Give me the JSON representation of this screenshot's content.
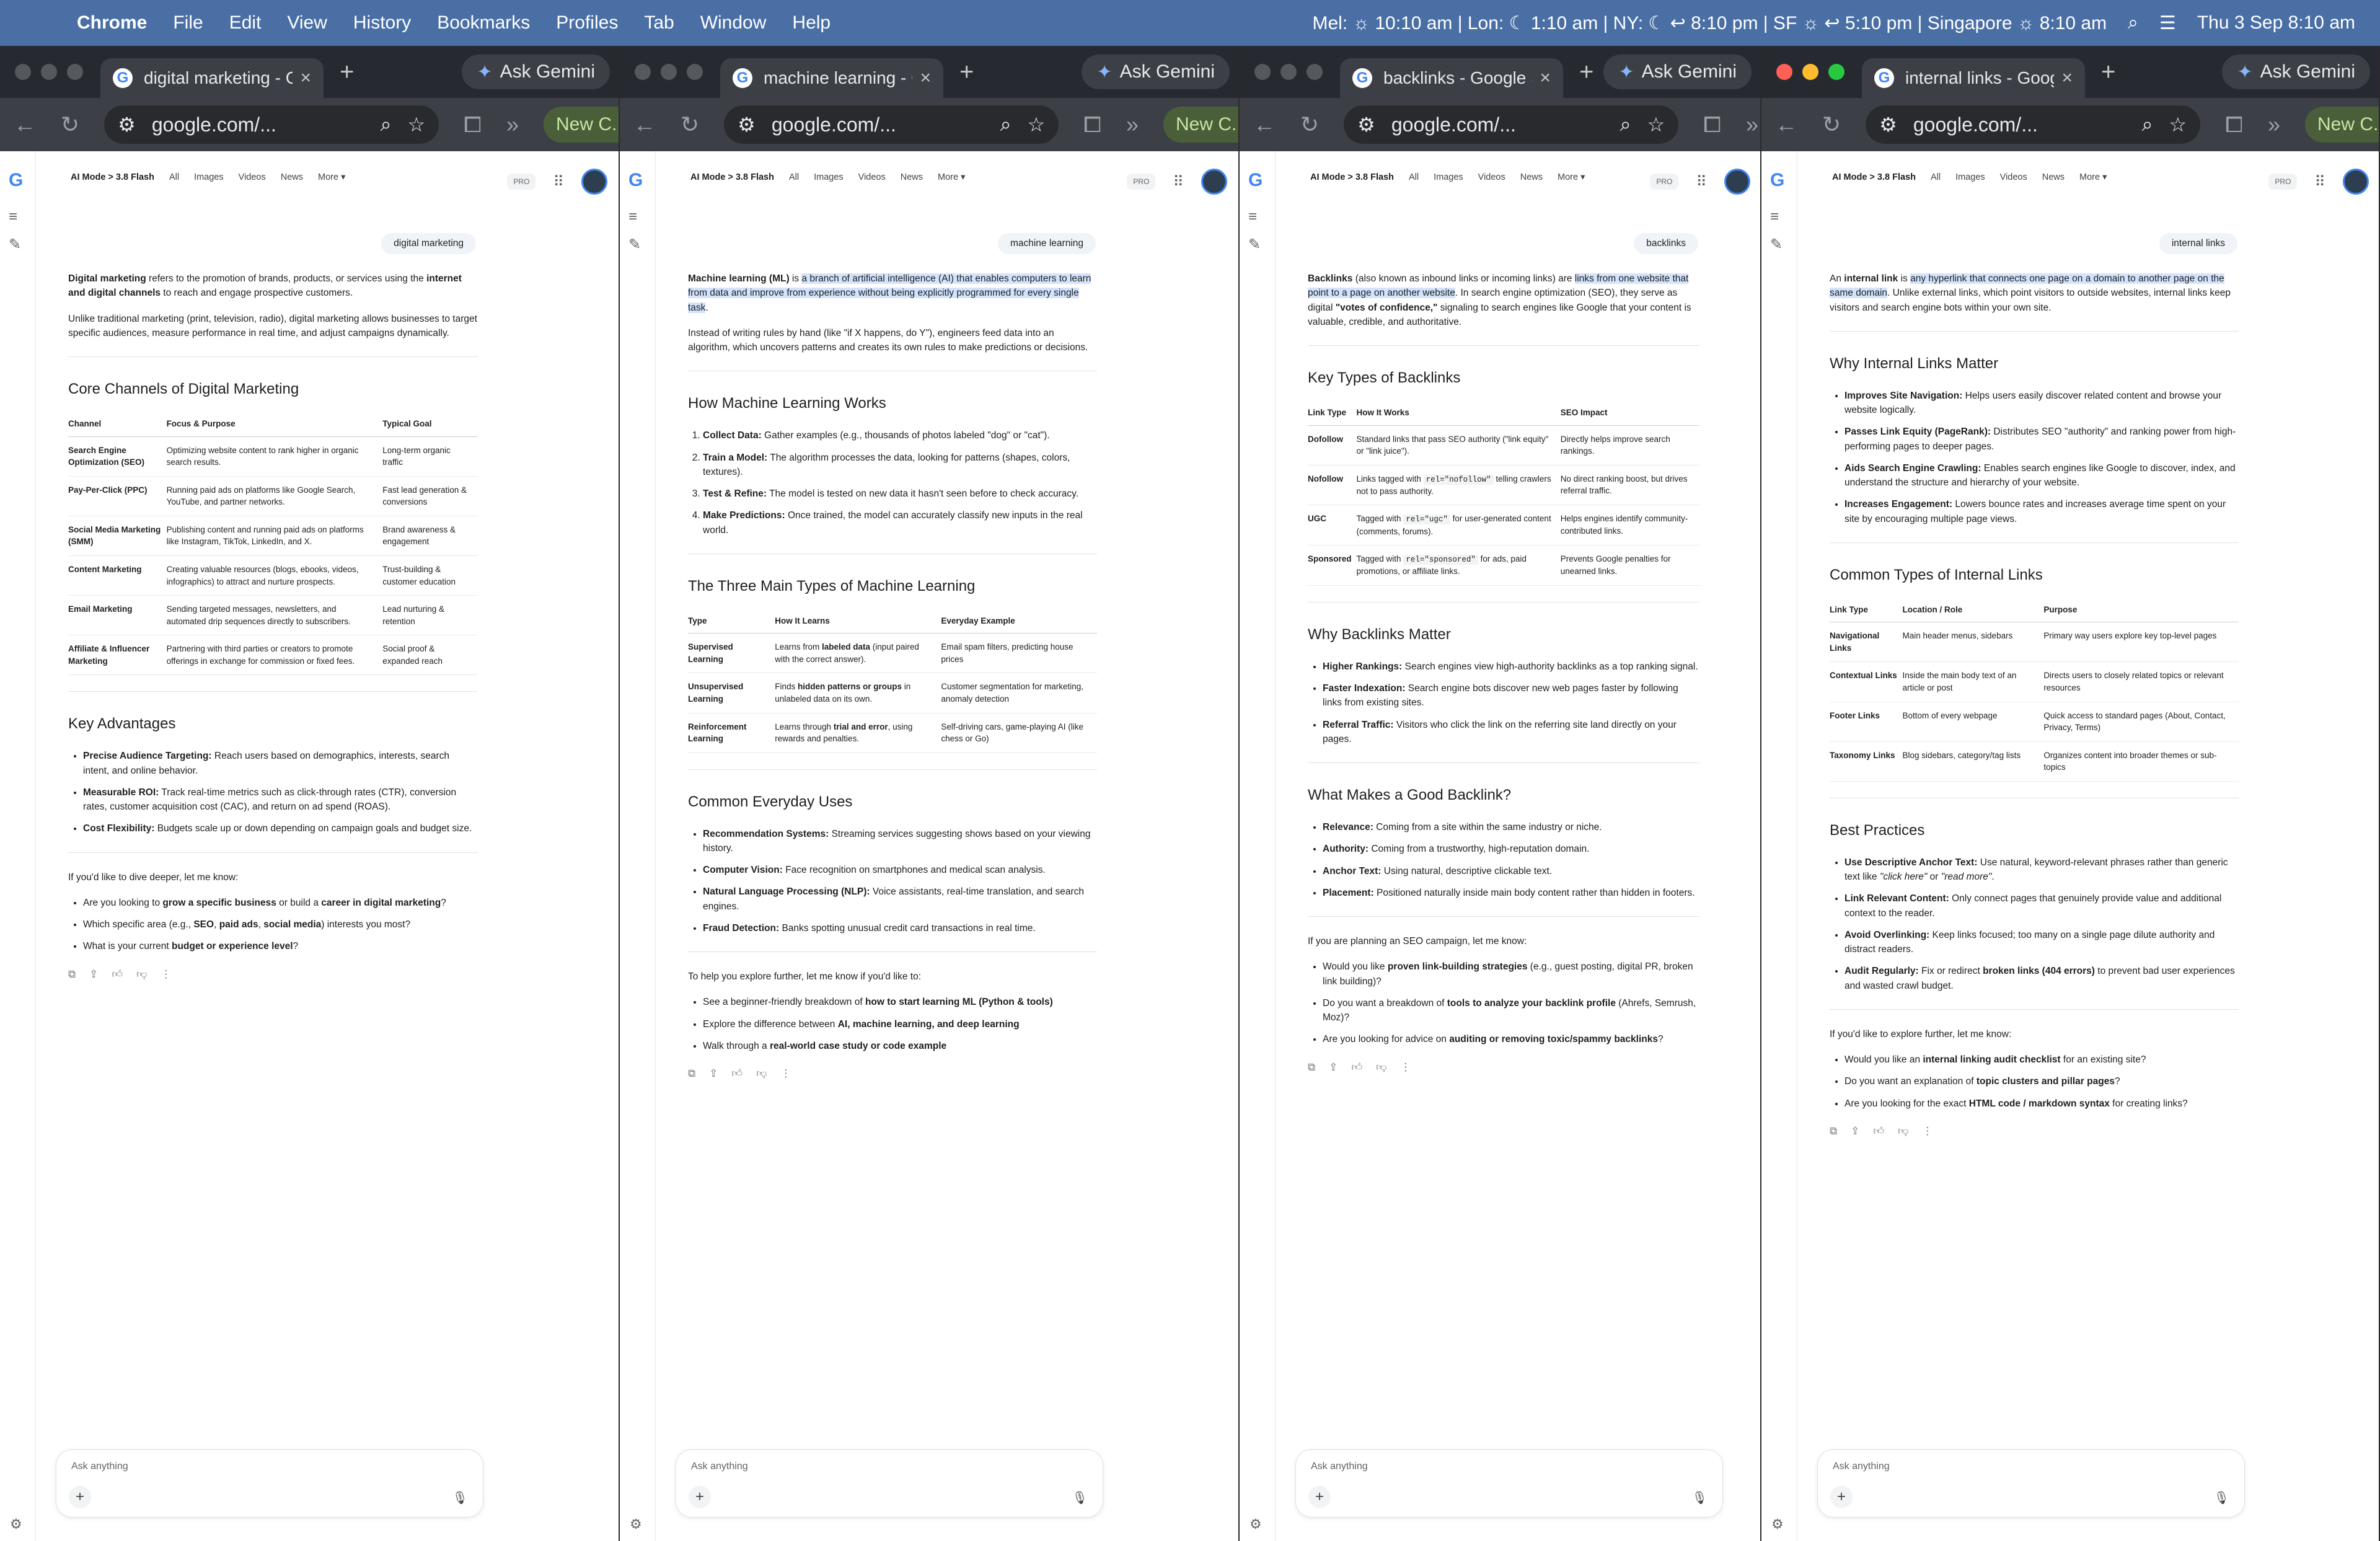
{
  "menubar": {
    "app": "Chrome",
    "items": [
      "File",
      "Edit",
      "View",
      "History",
      "Bookmarks",
      "Profiles",
      "Tab",
      "Window",
      "Help"
    ],
    "clock_strip": "Mel: ☼ 10:10 am | Lon: ☾ 1:10 am | NY: ☾ ↩ 8:10 pm | SF ☼ ↩ 5:10 pm | Singapore ☼ 8:10 am",
    "date": "Thu 3 Sep  8:10 am"
  },
  "common": {
    "ask_gemini": "Ask Gemini",
    "url": "google.com/...",
    "new_chat": "New C...",
    "nav_brand": "AI Mode > 3.8 Flash",
    "nav_items": [
      "All",
      "Images",
      "Videos",
      "News",
      "More ▾"
    ],
    "pro": "PRO",
    "ask_placeholder": "Ask anything"
  },
  "windows": [
    {
      "tab_title": "digital marketing - Google S",
      "query": "digital marketing",
      "intro": [
        "<b>Digital marketing</b> refers to the promotion of brands, products, or services using the <b>internet and digital channels</b> to reach and engage prospective customers.",
        "Unlike traditional marketing (print, television, radio), digital marketing allows businesses to target specific audiences, measure performance in real time, and adjust campaigns dynamically."
      ],
      "table_heading": "Core Channels of Digital Marketing",
      "table": {
        "headers": [
          "Channel",
          "Focus & Purpose",
          "Typical Goal"
        ],
        "rows": [
          [
            "Search Engine Optimization (SEO)",
            "Optimizing website content to rank higher in organic search results.",
            "Long-term organic traffic"
          ],
          [
            "Pay-Per-Click (PPC)",
            "Running paid ads on platforms like Google Search, YouTube, and partner networks.",
            "Fast lead generation & conversions"
          ],
          [
            "Social Media Marketing (SMM)",
            "Publishing content and running paid ads on platforms like Instagram, TikTok, LinkedIn, and X.",
            "Brand awareness & engagement"
          ],
          [
            "Content Marketing",
            "Creating valuable resources (blogs, ebooks, videos, infographics) to attract and nurture prospects.",
            "Trust-building & customer education"
          ],
          [
            "Email Marketing",
            "Sending targeted messages, newsletters, and automated drip sequences directly to subscribers.",
            "Lead nurturing & retention"
          ],
          [
            "Affiliate & Influencer Marketing",
            "Partnering with third parties or creators to promote offerings in exchange for commission or fixed fees.",
            "Social proof & expanded reach"
          ]
        ]
      },
      "list_heading": "Key Advantages",
      "list": [
        "<b>Precise Audience Targeting:</b> Reach users based on demographics, interests, search intent, and online behavior.",
        "<b>Measurable ROI:</b> Track real-time metrics such as click-through rates (CTR), conversion rates, customer acquisition cost (CAC), and return on ad spend (ROAS).",
        "<b>Cost Flexibility:</b> Budgets scale up or down depending on campaign goals and budget size."
      ],
      "followup_intro": "If you'd like to dive deeper, let me know:",
      "followups": [
        "Are you looking to <b>grow a specific business</b> or build a <b>career in digital marketing</b>?",
        "Which specific area (e.g., <b>SEO</b>, <b>paid ads</b>, <b>social media</b>) interests you most?",
        "What is your current <b>budget or experience level</b>?"
      ]
    },
    {
      "tab_title": "machine learning - Google S",
      "query": "machine learning",
      "intro": [
        "<b>Machine learning (ML)</b> is <span class=\"hl\">a branch of artificial intelligence (AI) that enables computers to learn from data and improve from experience without being explicitly programmed for every single task</span>.",
        "Instead of writing rules by hand (like \"if X happens, do Y\"), engineers feed data into an algorithm, which uncovers patterns and creates its own rules to make predictions or decisions."
      ],
      "steps_heading": "How Machine Learning Works",
      "steps": [
        "<b>Collect Data:</b> Gather examples (e.g., thousands of photos labeled \"dog\" or \"cat\").",
        "<b>Train a Model:</b> The algorithm processes the data, looking for patterns (shapes, colors, textures).",
        "<b>Test &amp; Refine:</b> The model is tested on new data it hasn't seen before to check accuracy.",
        "<b>Make Predictions:</b> Once trained, the model can accurately classify new inputs in the real world."
      ],
      "table_heading": "The Three Main Types of Machine Learning",
      "table": {
        "headers": [
          "Type",
          "How It Learns",
          "Everyday Example"
        ],
        "rows": [
          [
            "Supervised Learning",
            "Learns from <b>labeled data</b> (input paired with the correct answer).",
            "Email spam filters, predicting house prices"
          ],
          [
            "Unsupervised Learning",
            "Finds <b>hidden patterns or groups</b> in unlabeled data on its own.",
            "Customer segmentation for marketing, anomaly detection"
          ],
          [
            "Reinforcement Learning",
            "Learns through <b>trial and error</b>, using rewards and penalties.",
            "Self-driving cars, game-playing AI (like chess or Go)"
          ]
        ]
      },
      "list_heading": "Common Everyday Uses",
      "list": [
        "<b>Recommendation Systems:</b> Streaming services suggesting shows based on your viewing history.",
        "<b>Computer Vision:</b> Face recognition on smartphones and medical scan analysis.",
        "<b>Natural Language Processing (NLP):</b> Voice assistants, real-time translation, and search engines.",
        "<b>Fraud Detection:</b> Banks spotting unusual credit card transactions in real time."
      ],
      "followup_intro": "To help you explore further, let me know if you'd like to:",
      "followups": [
        "See a beginner-friendly breakdown of <b>how to start learning ML (Python &amp; tools)</b>",
        "Explore the difference between <b>AI, machine learning, and deep learning</b>",
        "Walk through a <b>real-world case study or code example</b>"
      ]
    },
    {
      "tab_title": "backlinks - Google Search",
      "query": "backlinks",
      "intro": [
        "<b>Backlinks</b> (also known as inbound links or incoming links) are <span class=\"hl\">links from one website that point to a page on another website</span>. In search engine optimization (SEO), they serve as digital <b>\"votes of confidence,\"</b> signaling to search engines like Google that your content is valuable, credible, and authoritative."
      ],
      "table_heading": "Key Types of Backlinks",
      "table": {
        "headers": [
          "Link Type",
          "How It Works",
          "SEO Impact"
        ],
        "rows": [
          [
            "Dofollow",
            "Standard links that pass SEO authority (\"link equity\" or \"link juice\").",
            "Directly helps improve search rankings."
          ],
          [
            "Nofollow",
            "Links tagged with <code>rel=\"nofollow\"</code> telling crawlers not to pass authority.",
            "No direct ranking boost, but drives referral traffic."
          ],
          [
            "UGC",
            "Tagged with <code>rel=\"ugc\"</code> for user-generated content (comments, forums).",
            "Helps engines identify community-contributed links."
          ],
          [
            "Sponsored",
            "Tagged with <code>rel=\"sponsored\"</code> for ads, paid promotions, or affiliate links.",
            "Prevents Google penalties for unearned links."
          ]
        ]
      },
      "list_heading": "Why Backlinks Matter",
      "list": [
        "<b>Higher Rankings:</b> Search engines view high-authority backlinks as a top ranking signal.",
        "<b>Faster Indexation:</b> Search engine bots discover new web pages faster by following links from existing sites.",
        "<b>Referral Traffic:</b> Visitors who click the link on the referring site land directly on your pages."
      ],
      "list2_heading": "What Makes a Good Backlink?",
      "list2": [
        "<b>Relevance:</b> Coming from a site within the same industry or niche.",
        "<b>Authority:</b> Coming from a trustworthy, high-reputation domain.",
        "<b>Anchor Text:</b> Using natural, descriptive clickable text.",
        "<b>Placement:</b> Positioned naturally inside main body content rather than hidden in footers."
      ],
      "followup_intro": "If you are planning an SEO campaign, let me know:",
      "followups": [
        "Would you like <b>proven link-building strategies</b> (e.g., guest posting, digital PR, broken link building)?",
        "Do you want a breakdown of <b>tools to analyze your backlink profile</b> (Ahrefs, Semrush, Moz)?",
        "Are you looking for advice on <b>auditing or removing toxic/spammy backlinks</b>?"
      ]
    },
    {
      "tab_title": "internal links - Google Se",
      "query": "internal links",
      "intro": [
        "An <b>internal link</b> is <span class=\"hl\">any hyperlink that connects one page on a domain to another page on the same domain</span>. Unlike external links, which point visitors to outside websites, internal links keep visitors and search engine bots within your own site."
      ],
      "list_heading": "Why Internal Links Matter",
      "list": [
        "<b>Improves Site Navigation:</b> Helps users easily discover related content and browse your website logically.",
        "<b>Passes Link Equity (PageRank):</b> Distributes SEO \"authority\" and ranking power from high-performing pages to deeper pages.",
        "<b>Aids Search Engine Crawling:</b> Enables search engines like Google to discover, index, and understand the structure and hierarchy of your website.",
        "<b>Increases Engagement:</b> Lowers bounce rates and increases average time spent on your site by encouraging multiple page views."
      ],
      "table_heading": "Common Types of Internal Links",
      "table": {
        "headers": [
          "Link Type",
          "Location / Role",
          "Purpose"
        ],
        "rows": [
          [
            "Navigational Links",
            "Main header menus, sidebars",
            "Primary way users explore key top-level pages"
          ],
          [
            "Contextual Links",
            "Inside the main body text of an article or post",
            "Directs users to closely related topics or relevant resources"
          ],
          [
            "Footer Links",
            "Bottom of every webpage",
            "Quick access to standard pages (About, Contact, Privacy, Terms)"
          ],
          [
            "Taxonomy Links",
            "Blog sidebars, category/tag lists",
            "Organizes content into broader themes or sub-topics"
          ]
        ]
      },
      "list2_heading": "Best Practices",
      "list2": [
        "<b>Use Descriptive Anchor Text:</b> Use natural, keyword-relevant phrases rather than generic text like <i>\"click here\"</i> or <i>\"read more\"</i>.",
        "<b>Link Relevant Content:</b> Only connect pages that genuinely provide value and additional context to the reader.",
        "<b>Avoid Overlinking:</b> Keep links focused; too many on a single page dilute authority and distract readers.",
        "<b>Audit Regularly:</b> Fix or redirect <b>broken links (404 errors)</b> to prevent bad user experiences and wasted crawl budget."
      ],
      "followup_intro": "If you'd like to explore further, let me know:",
      "followups": [
        "Would you like an <b>internal linking audit checklist</b> for an existing site?",
        "Do you want an explanation of <b>topic clusters and pillar pages</b>?",
        "Are you looking for the exact <b>HTML code / markdown syntax</b> for creating links?"
      ]
    }
  ]
}
